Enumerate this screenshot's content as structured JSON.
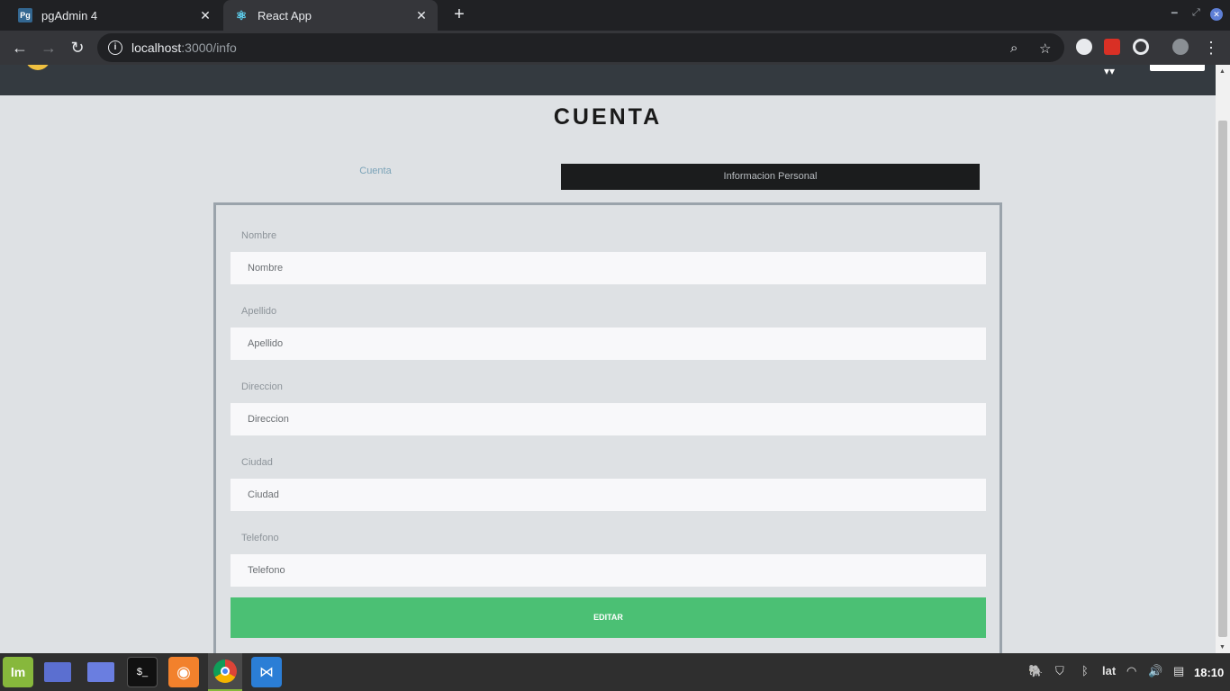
{
  "browser": {
    "tabs": [
      {
        "title": "pgAdmin 4",
        "favicon": "Pg",
        "active": false
      },
      {
        "title": "React App",
        "favicon": "react-icon",
        "active": true
      }
    ],
    "url_host": "localhost",
    "url_path": ":3000/info"
  },
  "page": {
    "heading": "CUENTA",
    "tabs": {
      "cuenta": "Cuenta",
      "info": "Informacion Personal"
    },
    "fields": [
      {
        "label": "Nombre",
        "placeholder": "Nombre"
      },
      {
        "label": "Apellido",
        "placeholder": "Apellido"
      },
      {
        "label": "Direccion",
        "placeholder": "Direccion"
      },
      {
        "label": "Ciudad",
        "placeholder": "Ciudad"
      },
      {
        "label": "Telefono",
        "placeholder": "Telefono"
      }
    ],
    "submit_label": "EDITAR"
  },
  "taskbar": {
    "keyboard_layout": "lat",
    "clock": "18:10"
  },
  "colors": {
    "accent_green": "#4bc074",
    "nav_dark": "#343a40",
    "tab_active_bg": "#1b1c1d"
  }
}
